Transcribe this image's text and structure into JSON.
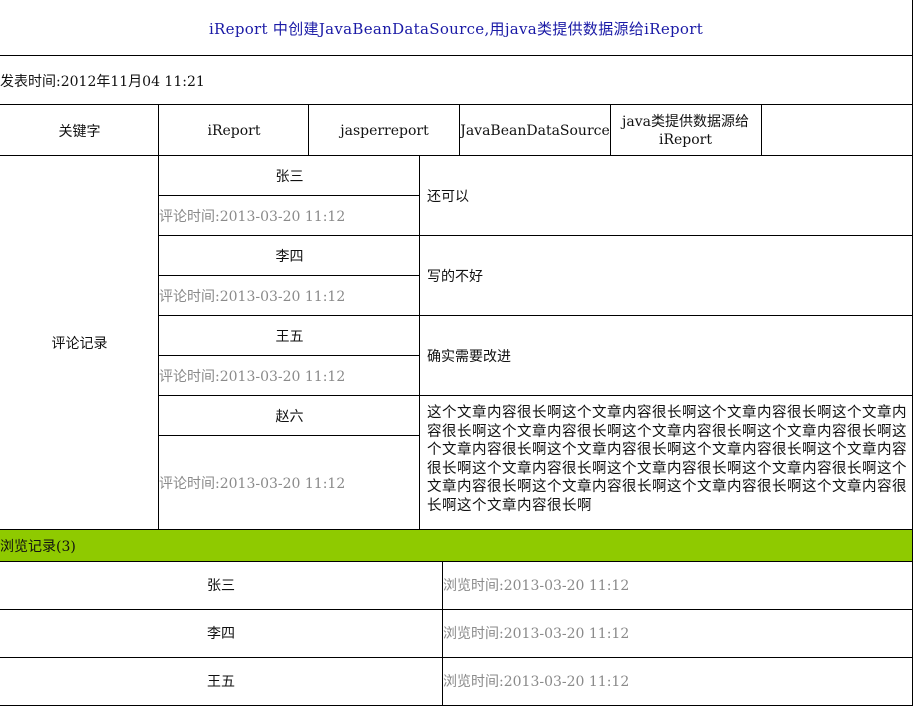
{
  "title": "iReport 中创建JavaBeanDataSource,用java类提供数据源给iReport",
  "publish_time": "发表时间:2012年11月04 11:21",
  "keywords": {
    "label": "关键字",
    "items": [
      "iReport",
      "jasperreport",
      "JavaBeanDataSource",
      "java类提供数据源给iReport",
      ""
    ]
  },
  "comments": {
    "label": "评论记录",
    "items": [
      {
        "author": "张三",
        "time": "评论时间:2013-03-20 11:12",
        "content": "还可以"
      },
      {
        "author": "李四",
        "time": "评论时间:2013-03-20 11:12",
        "content": "写的不好"
      },
      {
        "author": "王五",
        "time": "评论时间:2013-03-20 11:12",
        "content": "确实需要改进"
      },
      {
        "author": "赵六",
        "time": "评论时间:2013-03-20 11:12",
        "content": "这个文章内容很长啊这个文章内容很长啊这个文章内容很长啊这个文章内容很长啊这个文章内容很长啊这个文章内容很长啊这个文章内容很长啊这个文章内容很长啊这个文章内容很长啊这个文章内容很长啊这个文章内容很长啊这个文章内容很长啊这个文章内容很长啊这个文章内容很长啊这个文章内容很长啊这个文章内容很长啊这个文章内容很长啊这个文章内容很长啊这个文章内容很长啊"
      }
    ]
  },
  "views": {
    "label": "浏览记录(3)",
    "items": [
      {
        "name": "张三",
        "time": "浏览时间:2013-03-20 11:12"
      },
      {
        "name": "李四",
        "time": "浏览时间:2013-03-20 11:12"
      },
      {
        "name": "王五",
        "time": "浏览时间:2013-03-20 11:12"
      }
    ]
  },
  "colors": {
    "title": "#1a1aa6",
    "section_bar": "#8fca00",
    "muted": "#8a8a8a"
  }
}
